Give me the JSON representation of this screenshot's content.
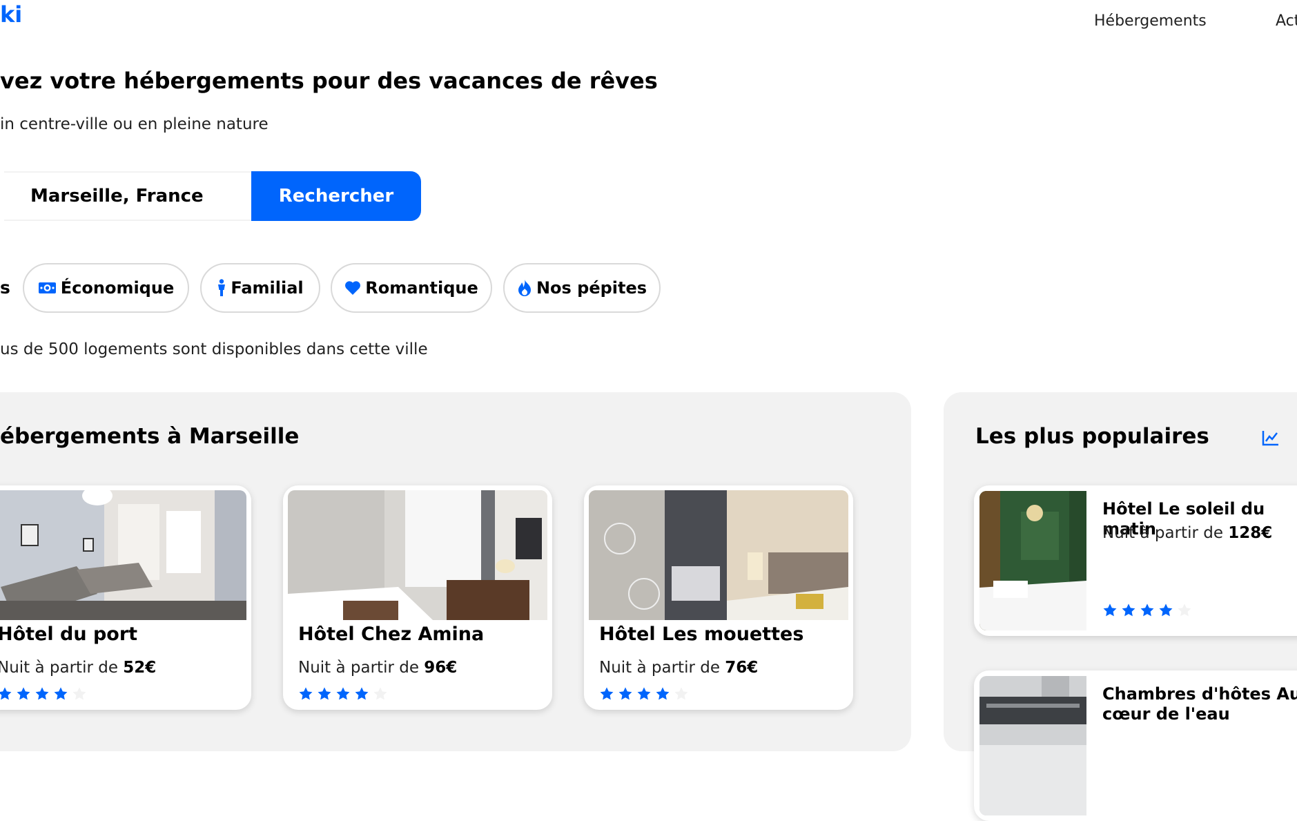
{
  "header": {
    "logo": "ki",
    "nav": [
      "Hébergements",
      "Act"
    ]
  },
  "hero": {
    "title": "vez votre hébergements pour des vacances de rêves",
    "subtitle": "in centre-ville ou en pleine nature"
  },
  "search": {
    "value": "Marseille, France",
    "button": "Rechercher"
  },
  "filters": {
    "partial_label": "s",
    "items": [
      {
        "label": "Économique",
        "icon": "money-icon"
      },
      {
        "label": "Familial",
        "icon": "person-icon"
      },
      {
        "label": "Romantique",
        "icon": "heart-icon"
      },
      {
        "label": "Nos pépites",
        "icon": "fire-icon"
      }
    ]
  },
  "availability": "us de 500 logements sont disponibles dans cette ville",
  "listings": {
    "title": "ébergements à Marseille",
    "cards": [
      {
        "name": "Hôtel du port",
        "price_prefix": "Nuit à partir de ",
        "price": "52€",
        "rating": 4,
        "max": 5
      },
      {
        "name": "Hôtel Chez Amina",
        "price_prefix": "Nuit à partir de ",
        "price": "96€",
        "rating": 4,
        "max": 5
      },
      {
        "name": "Hôtel Les mouettes",
        "price_prefix": "Nuit à partir de ",
        "price": "76€",
        "rating": 4,
        "max": 5
      }
    ]
  },
  "popular": {
    "title": "Les plus populaires",
    "icon": "trend-chart-icon",
    "cards": [
      {
        "name": "Hôtel Le soleil du matin",
        "price_prefix": "Nuit à partir de ",
        "price": "128€",
        "rating": 4,
        "max": 5
      },
      {
        "name": "Chambres d'hôtes Au cœur de l'eau"
      }
    ]
  },
  "colors": {
    "accent": "#0065fc",
    "panel": "#f2f2f2",
    "star_empty": "#f2f2f2"
  }
}
